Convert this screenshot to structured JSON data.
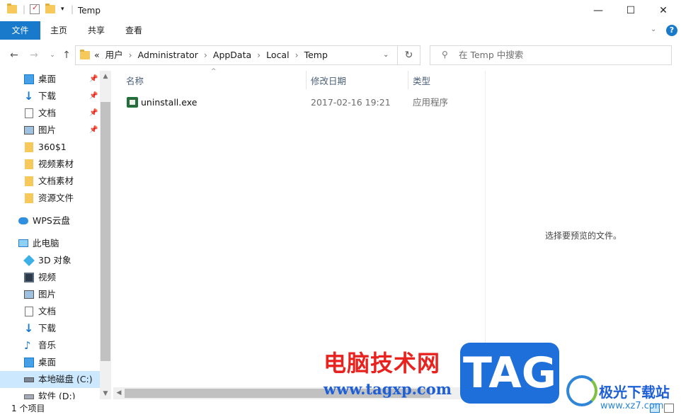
{
  "window": {
    "title": "Temp",
    "minimize_glyph": "—",
    "maximize_glyph": "☐",
    "close_glyph": "✕"
  },
  "ribbon": {
    "tabs": [
      "文件",
      "主页",
      "共享",
      "查看"
    ],
    "help_glyph": "?"
  },
  "address": {
    "overflow": "«",
    "crumbs": [
      "用户",
      "Administrator",
      "AppData",
      "Local",
      "Temp"
    ],
    "search_placeholder": "在 Temp 中搜索"
  },
  "nav": {
    "quick_access": [
      {
        "label": "桌面",
        "icon": "desktop-icon",
        "pinned": true
      },
      {
        "label": "下载",
        "icon": "download-icon",
        "pinned": true
      },
      {
        "label": "文档",
        "icon": "document-icon",
        "pinned": true
      },
      {
        "label": "图片",
        "icon": "picture-icon",
        "pinned": true
      },
      {
        "label": "360$1",
        "icon": "folder-icon",
        "pinned": false
      },
      {
        "label": "视频素材",
        "icon": "folder-icon",
        "pinned": false
      },
      {
        "label": "文档素材",
        "icon": "folder-icon",
        "pinned": false
      },
      {
        "label": "资源文件",
        "icon": "folder-icon",
        "pinned": false
      }
    ],
    "wps": "WPS云盘",
    "this_pc": "此电脑",
    "pc_items": [
      {
        "label": "3D 对象",
        "icon": "3d-objects-icon"
      },
      {
        "label": "视频",
        "icon": "video-icon"
      },
      {
        "label": "图片",
        "icon": "picture-icon"
      },
      {
        "label": "文档",
        "icon": "document-icon"
      },
      {
        "label": "下载",
        "icon": "download-icon"
      },
      {
        "label": "音乐",
        "icon": "music-icon"
      },
      {
        "label": "桌面",
        "icon": "desktop-icon"
      },
      {
        "label": "本地磁盘 (C:)",
        "icon": "drive-icon"
      },
      {
        "label": "软件 (D:)",
        "icon": "drive-icon"
      }
    ]
  },
  "columns": {
    "name": "名称",
    "date": "修改日期",
    "type": "类型"
  },
  "files": [
    {
      "name": "uninstall.exe",
      "date": "2017-02-16 19:21",
      "type": "应用程序"
    }
  ],
  "preview": {
    "message": "选择要预览的文件。"
  },
  "status": {
    "count": "1 个项目"
  },
  "watermark": {
    "site_name": "电脑技术网",
    "site_url": "www.tagxp.com",
    "tag": "TAG",
    "brand": "极光下载站",
    "brand_url": "www.xz7.com"
  },
  "colors": {
    "accent": "#1979ca",
    "selection": "#cce8ff",
    "folder": "#f6c95a"
  }
}
